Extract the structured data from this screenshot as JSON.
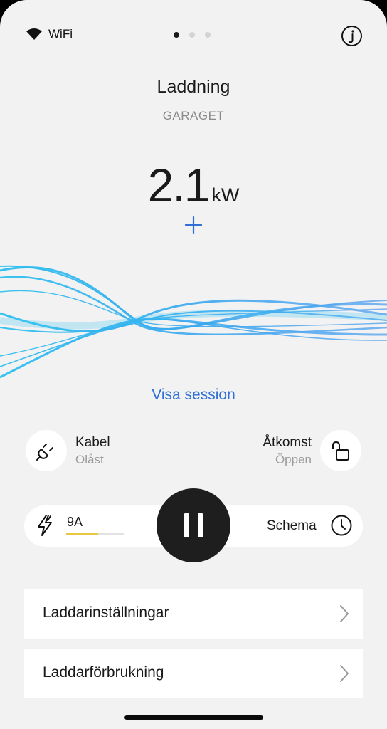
{
  "status": {
    "network_label": "WiFi",
    "network_icon": "wifi-icon"
  },
  "pager": {
    "count": 3,
    "active_index": 0
  },
  "header": {
    "title": "Laddning",
    "subtitle": "GARAGET"
  },
  "power": {
    "value": "2.1",
    "unit": "kW"
  },
  "session": {
    "link_label": "Visa session"
  },
  "cable": {
    "label": "Kabel",
    "status": "Olåst",
    "icon": "plug-icon"
  },
  "access": {
    "label": "Åtkomst",
    "status": "Öppen",
    "icon": "unlocked-padlock-icon"
  },
  "controls": {
    "current_label": "9A",
    "current_level_fraction": 0.55,
    "current_bar_color": "#e8c840",
    "pause_icon": "pause-icon",
    "schedule_label": "Schema",
    "schedule_icon": "clock-icon"
  },
  "menu": [
    {
      "label": "Laddarinställningar"
    },
    {
      "label": "Laddarförbrukning"
    }
  ],
  "colors": {
    "accent": "#2f6fd6",
    "background": "#f2f2f2",
    "wave": "#3ab8f0"
  }
}
